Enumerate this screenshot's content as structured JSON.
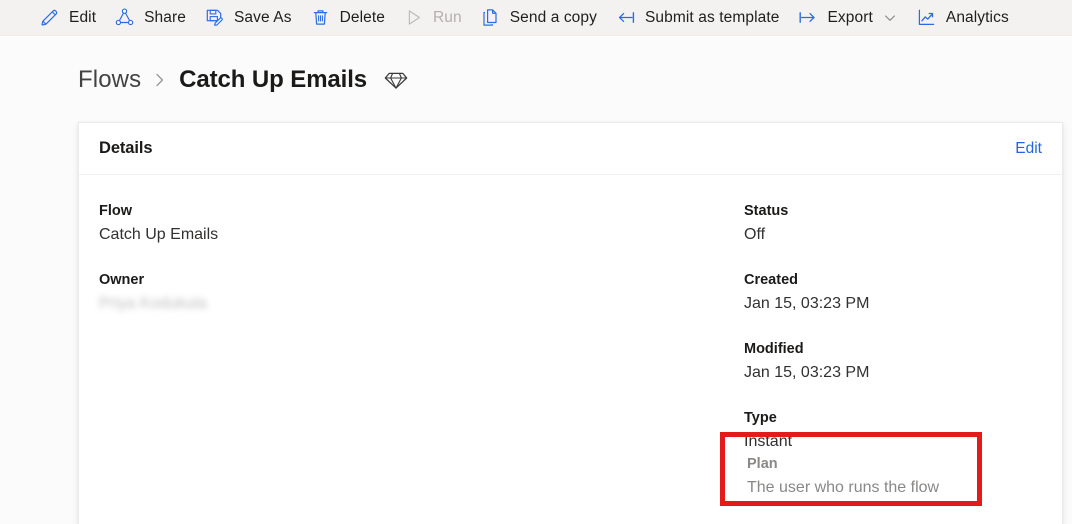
{
  "commandbar": {
    "items": [
      {
        "label": "Edit",
        "icon": "pencil-icon",
        "disabled": false,
        "chevron": false
      },
      {
        "label": "Share",
        "icon": "share-icon",
        "disabled": false,
        "chevron": false
      },
      {
        "label": "Save As",
        "icon": "save-as-icon",
        "disabled": false,
        "chevron": false
      },
      {
        "label": "Delete",
        "icon": "trash-icon",
        "disabled": false,
        "chevron": false
      },
      {
        "label": "Run",
        "icon": "play-icon",
        "disabled": true,
        "chevron": false
      },
      {
        "label": "Send a copy",
        "icon": "copy-icon",
        "disabled": false,
        "chevron": false
      },
      {
        "label": "Submit as template",
        "icon": "arrow-to-bar-left-icon",
        "disabled": false,
        "chevron": false
      },
      {
        "label": "Export",
        "icon": "arrow-from-bar-right-icon",
        "disabled": false,
        "chevron": true
      },
      {
        "label": "Analytics",
        "icon": "line-chart-icon",
        "disabled": false,
        "chevron": false
      }
    ]
  },
  "breadcrumb": {
    "parent": "Flows",
    "separator": "chevron-right-icon",
    "current": "Catch Up Emails",
    "badge_icon": "gem-icon"
  },
  "card": {
    "title": "Details",
    "edit_label": "Edit",
    "left_fields": [
      {
        "label": "Flow",
        "value": "Catch Up Emails"
      },
      {
        "label": "Owner",
        "value": "Priya Kodukula"
      }
    ],
    "right_fields": [
      {
        "label": "Status",
        "value": "Off"
      },
      {
        "label": "Created",
        "value": "Jan 15, 03:23 PM"
      },
      {
        "label": "Modified",
        "value": "Jan 15, 03:23 PM"
      },
      {
        "label": "Type",
        "value": "Instant"
      }
    ],
    "plan_field": {
      "label": "Plan",
      "value": "The user who runs the flow"
    }
  },
  "colors": {
    "icon_blue": "#2b6ce6",
    "link_blue": "#2266e3",
    "highlight_red": "#e51b1b",
    "disabled_gray": "#b3b0ad",
    "muted_gray": "#8a8886",
    "commandbar_bg": "#f3f2f1",
    "page_bg": "#fbfbfb",
    "card_bg": "#ffffff"
  }
}
